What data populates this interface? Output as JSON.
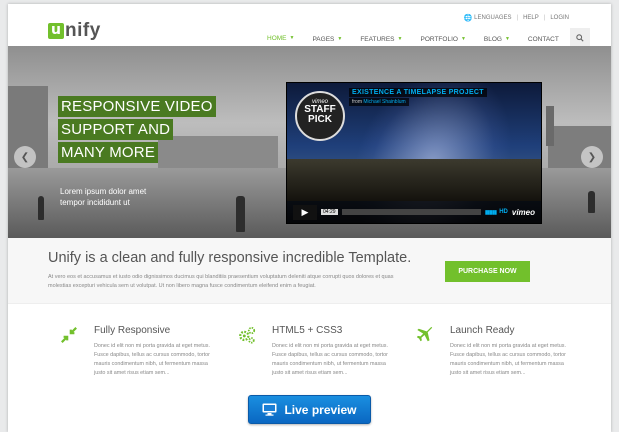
{
  "header": {
    "logo_mark": "u",
    "logo_rest": "nify",
    "topbar": {
      "languages": "LENGUAGES",
      "help": "HELP",
      "login": "LOGIN"
    },
    "nav": [
      {
        "label": "HOME",
        "active": true,
        "caret": true
      },
      {
        "label": "PAGES",
        "active": false,
        "caret": true
      },
      {
        "label": "FEATURES",
        "active": false,
        "caret": true
      },
      {
        "label": "PORTFOLIO",
        "active": false,
        "caret": true
      },
      {
        "label": "BLOG",
        "active": false,
        "caret": true
      },
      {
        "label": "CONTACT",
        "active": false,
        "caret": false
      }
    ],
    "search_icon": "search-icon"
  },
  "hero": {
    "lines": [
      "RESPONSIVE VIDEO",
      "SUPPORT AND",
      "MANY MORE"
    ],
    "sub1": "Lorem ipsum dolor amet",
    "sub2": "tempor incididunt ut",
    "prev_icon": "chevron-left-icon",
    "next_icon": "chevron-right-icon"
  },
  "video": {
    "title": "EXISTENCE A TIMELAPSE PROJECT",
    "from_prefix": "from",
    "author": "Michael Shainblum",
    "badge_top": "vimeo",
    "badge_l1": "STAFF",
    "badge_l2": "PICK",
    "time": "04:29",
    "hd": "HD",
    "brand": "vimeo"
  },
  "purchase": {
    "title": "Unify is a clean and fully responsive incredible Template.",
    "text": "At vero eos et accusamus et iusto odio dignissimos ducimus qui blanditiis praesentium voluptatum deleniti atque corrupti quos dolores et quas molestias excepturi vehicula sem ut volutpat. Ut non libero magna fusce condimentum eleifend enim a feugiat.",
    "button": "PURCHASE NOW"
  },
  "features": [
    {
      "title": "Fully Responsive",
      "icon": "compress-arrows-icon",
      "text": "Donec id elit non mi porta gravida at eget metus. Fusce dapibus, tellus ac cursus commodo, tortor mauris condimentum nibh, ut fermentum massa justo sit amet risus etiam sem..."
    },
    {
      "title": "HTML5 + CSS3",
      "icon": "gears-icon",
      "text": "Donec id elit non mi porta gravida at eget metus. Fusce dapibus, tellus ac cursus commodo, tortor mauris condimentum nibh, ut fermentum massa justo sit amet risus etiam sem..."
    },
    {
      "title": "Launch Ready",
      "icon": "plane-icon",
      "text": "Donec id elit non mi porta gravida at eget metus. Fusce dapibus, tellus ac cursus commodo, tortor mauris condimentum nibh, ut fermentum massa justo sit amet risus etiam sem..."
    }
  ],
  "live_preview": {
    "label": "Live preview",
    "icon": "monitor-icon"
  },
  "colors": {
    "accent": "#72c02c",
    "hero_green": "#4a7a21",
    "live_blue": "#0a67c2",
    "vimeo_blue": "#00adef"
  }
}
